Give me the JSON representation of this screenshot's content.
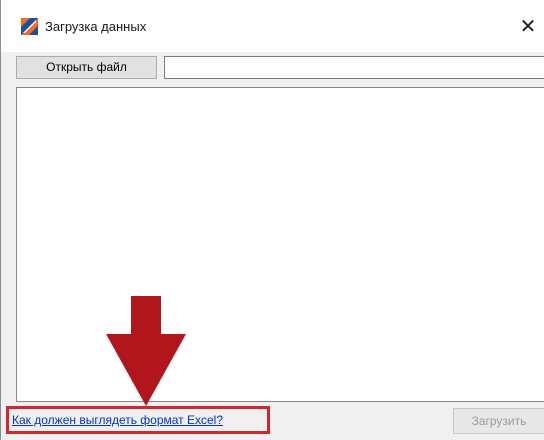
{
  "window": {
    "title": "Загрузка данных",
    "app_icon": "app-logo-icon",
    "close_glyph": "✕"
  },
  "toolbar": {
    "open_file_label": "Открыть файл",
    "file_path_value": ""
  },
  "footer": {
    "excel_format_link": "Как должен выглядеть формат Excel?",
    "load_label": "Загрузить",
    "load_enabled": false
  },
  "annotations": {
    "arrow_icon": "arrow-down-icon",
    "arrow_color": "#b0161c",
    "highlight_color": "#d0262e"
  },
  "colors": {
    "link": "#0033cc",
    "disabled_text": "#9a9a9a",
    "icon_orange": "#f26b21",
    "icon_blue": "#1b4f9c"
  }
}
